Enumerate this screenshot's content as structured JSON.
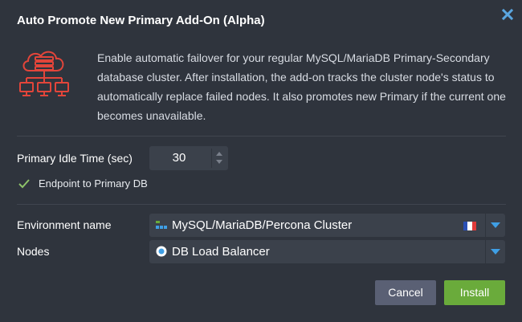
{
  "dialog": {
    "title": "Auto Promote New Primary Add-On (Alpha)",
    "description": "Enable automatic failover for your regular MySQL/MariaDB Primary-Secondary database cluster. After installation, the add-on tracks the cluster node's status to automatically replace failed nodes. It also promotes new Primary if the current one becomes unavailable."
  },
  "form": {
    "idle_time": {
      "label": "Primary Idle Time (sec)",
      "value": "30"
    },
    "endpoint": {
      "label": "Endpoint to Primary DB",
      "checked": true
    },
    "environment": {
      "label": "Environment name",
      "value": "MySQL/MariaDB/Percona Cluster"
    },
    "nodes": {
      "label": "Nodes",
      "value": "DB Load Balancer"
    }
  },
  "buttons": {
    "cancel": "Cancel",
    "install": "Install"
  },
  "icons": {
    "close": "close-icon",
    "hero": "cloud-network-icon",
    "checkbox": "check-icon",
    "environment": "cluster-icon",
    "nodes": "load-balancer-icon",
    "flag": "france-flag-icon"
  },
  "colors": {
    "dialog_bg": "#2f343d",
    "field_bg": "#3b414b",
    "accent_blue": "#3f9fe5",
    "install_green": "#6aab3b",
    "cancel_gray": "#5a6074",
    "hero_red": "#e3453a",
    "check_green": "#8ec36a"
  }
}
